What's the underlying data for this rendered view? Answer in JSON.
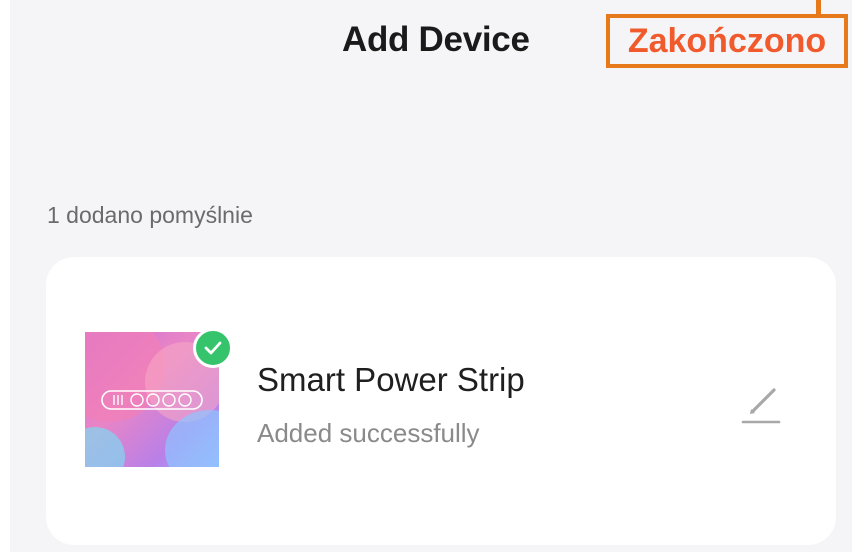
{
  "header": {
    "title": "Add Device",
    "done_label": "Zakończono"
  },
  "summary": {
    "success_count_text": "1 dodano pomyślnie"
  },
  "device": {
    "name": "Smart Power Strip",
    "status": "Added successfully",
    "image_icon": "power-strip-image",
    "badge_icon": "check-icon",
    "edit_icon": "pencil-icon"
  },
  "colors": {
    "accent_orange": "#f05a2c",
    "highlight_border": "#e67a1a",
    "success_green": "#35c46b",
    "background": "#f5f5f7",
    "card": "#ffffff"
  }
}
